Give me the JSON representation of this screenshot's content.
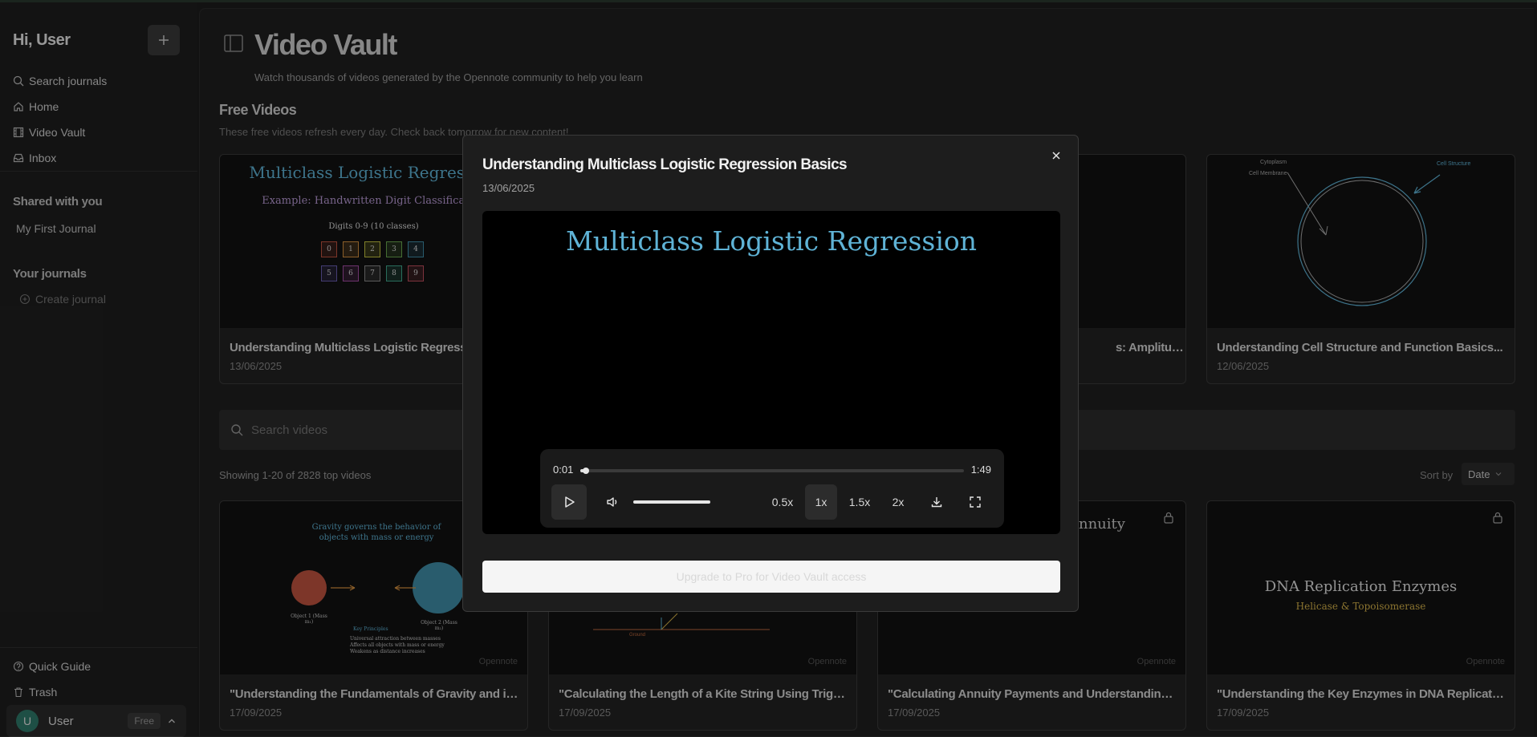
{
  "sidebar": {
    "greeting": "Hi, User",
    "nav": [
      {
        "label": "Search journals",
        "icon": "search-icon"
      },
      {
        "label": "Home",
        "icon": "home-icon"
      },
      {
        "label": "Video Vault",
        "icon": "film-icon"
      },
      {
        "label": "Inbox",
        "icon": "inbox-icon"
      }
    ],
    "shared_title": "Shared with you",
    "shared_items": [
      "My First Journal"
    ],
    "journals_title": "Your journals",
    "create_journal": "Create journal",
    "quick_guide": "Quick Guide",
    "trash": "Trash",
    "user": {
      "initial": "U",
      "name": "User",
      "plan": "Free"
    }
  },
  "main": {
    "title": "Video Vault",
    "subtitle": "Watch thousands of videos generated by the Opennote community to help you learn",
    "free_title": "Free Videos",
    "free_subtitle": "These free videos refresh every day. Check back tomorrow for new content!",
    "free_cards": [
      {
        "title": "Understanding Multiclass Logistic Regression Basics",
        "date": "13/06/2025",
        "thumb_title": "Multiclass Logistic Regression",
        "thumb_sub": "Example: Handwritten Digit Classification",
        "thumb_note": "Digits 0-9 (10 classes)",
        "digits": [
          "0",
          "1",
          "2",
          "3",
          "4",
          "5",
          "6",
          "7",
          "8",
          "9"
        ]
      },
      {
        "title": "Understanding Waves: Amplitude, Wavelength and Frequency",
        "date": "",
        "visible_title": "s: Amplitude, Wa..."
      },
      {
        "title": "Understanding Cell Structure and Function Basics...",
        "date": "12/06/2025",
        "thumb_labels": [
          "Cytoplasm",
          "Cell Membrane",
          "Cell Structure"
        ]
      }
    ],
    "search_placeholder": "Search videos",
    "showing": "Showing 1-20 of 2828 top videos",
    "sort_label": "Sort by",
    "sort_value": "Date",
    "brand": "Opennote",
    "video_cards": [
      {
        "title": "\"Understanding the Fundamentals of Gravity and its ...",
        "date": "17/09/2025",
        "thumb_title": "Gravity governs the behavior of objects with mass or energy",
        "thumb_object1": "Object 1 (Mass m₁)",
        "thumb_object2": "Object 2 (Mass m₂)",
        "thumb_key": "Key Principles",
        "thumb_bullets": [
          "Universal attraction between masses",
          "Affects all objects with mass or energy",
          "Weakens as distance increases"
        ]
      },
      {
        "title": "\"Calculating the Length of a Kite String Using Trigon...",
        "date": "17/09/2025",
        "thumb_ground": "Ground"
      },
      {
        "title": "\"Calculating Annuity Payments and Understanding P...",
        "date": "17/09/2025",
        "thumb_text": "nnuity"
      },
      {
        "title": "\"Understanding the Key Enzymes in DNA Replication\"",
        "date": "17/09/2025",
        "thumb_title": "DNA Replication Enzymes",
        "thumb_sub": "Helicase & Topoisomerase"
      }
    ]
  },
  "modal": {
    "title": "Understanding Multiclass Logistic Regression Basics",
    "date": "13/06/2025",
    "video_caption": "Multiclass Logistic Regression",
    "time_current": "0:01",
    "time_total": "1:49",
    "progress": 0.01,
    "volume": 1.0,
    "speeds": [
      "0.5x",
      "1x",
      "1.5x",
      "2x"
    ],
    "active_speed": "1x",
    "upgrade_label": "Upgrade to Pro for Video Vault access"
  },
  "colors": {
    "accent_teal": "#5fb3d6",
    "avatar": "#2f7a6a",
    "gold": "#d6b34a"
  }
}
